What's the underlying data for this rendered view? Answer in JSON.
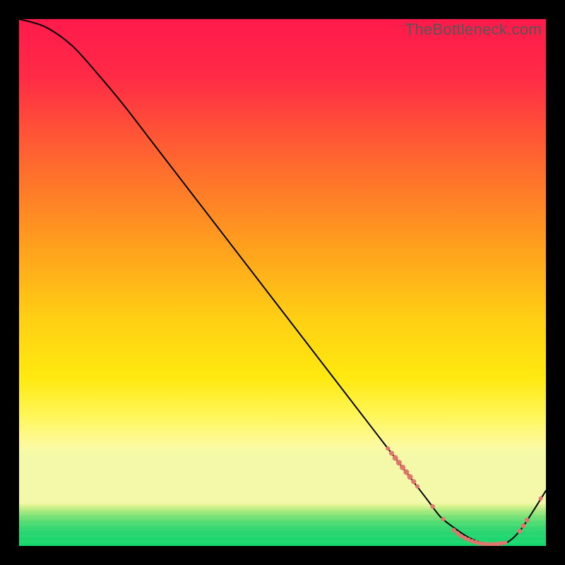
{
  "watermark": "TheBottleneck.com",
  "colors": {
    "frame": "#000000",
    "top": "#ff1a46",
    "mid": "#ffe400",
    "bottom_green": "#14d86d",
    "curve": "#000000",
    "marker": "#e2766d"
  },
  "chart_data": {
    "type": "line",
    "title": "",
    "xlabel": "",
    "ylabel": "",
    "xlim": [
      0,
      100
    ],
    "ylim": [
      0,
      100
    ],
    "series": [
      {
        "name": "bottleneck-curve",
        "x": [
          0,
          5,
          10,
          15,
          20,
          25,
          30,
          35,
          40,
          45,
          50,
          55,
          60,
          65,
          70,
          72.5,
          75,
          77.5,
          80,
          82.5,
          85,
          87.5,
          90,
          92.5,
          95,
          97.5,
          100
        ],
        "values": [
          100,
          98.5,
          95,
          89.5,
          83.5,
          77,
          70.5,
          64,
          57.5,
          51,
          44.5,
          38,
          31.5,
          25,
          18.5,
          15.25,
          12,
          8.75,
          5.5,
          3.5,
          1.8,
          0.7,
          0.3,
          0.6,
          2.8,
          6.5,
          10.5
        ]
      }
    ],
    "markers": {
      "comment": "red clusters of data points along the curve near its minimum and rising tail",
      "points": [
        {
          "x": 70.0,
          "y": 18.5,
          "r": 3.0
        },
        {
          "x": 70.7,
          "y": 17.6,
          "r": 3.5
        },
        {
          "x": 71.4,
          "y": 16.7,
          "r": 4.0
        },
        {
          "x": 72.1,
          "y": 15.8,
          "r": 4.0
        },
        {
          "x": 72.8,
          "y": 14.9,
          "r": 4.0
        },
        {
          "x": 73.5,
          "y": 14.0,
          "r": 4.0
        },
        {
          "x": 74.2,
          "y": 13.1,
          "r": 4.0
        },
        {
          "x": 74.9,
          "y": 12.2,
          "r": 3.5
        },
        {
          "x": 75.6,
          "y": 11.3,
          "r": 3.0
        },
        {
          "x": 78.5,
          "y": 7.5,
          "r": 3.2
        },
        {
          "x": 80.5,
          "y": 5.1,
          "r": 3.0
        },
        {
          "x": 82.5,
          "y": 3.0,
          "r": 3.2
        },
        {
          "x": 83.2,
          "y": 2.4,
          "r": 3.2
        },
        {
          "x": 83.9,
          "y": 1.9,
          "r": 3.2
        },
        {
          "x": 84.6,
          "y": 1.5,
          "r": 3.2
        },
        {
          "x": 85.3,
          "y": 1.2,
          "r": 3.2
        },
        {
          "x": 86.0,
          "y": 0.9,
          "r": 3.2
        },
        {
          "x": 86.7,
          "y": 0.7,
          "r": 3.2
        },
        {
          "x": 87.4,
          "y": 0.5,
          "r": 3.2
        },
        {
          "x": 88.1,
          "y": 0.4,
          "r": 3.2
        },
        {
          "x": 88.8,
          "y": 0.3,
          "r": 3.2
        },
        {
          "x": 89.5,
          "y": 0.3,
          "r": 3.2
        },
        {
          "x": 90.2,
          "y": 0.3,
          "r": 3.2
        },
        {
          "x": 90.9,
          "y": 0.4,
          "r": 3.2
        },
        {
          "x": 91.6,
          "y": 0.5,
          "r": 3.2
        },
        {
          "x": 92.3,
          "y": 0.6,
          "r": 2.8
        },
        {
          "x": 95.0,
          "y": 2.8,
          "r": 3.4
        },
        {
          "x": 95.7,
          "y": 3.8,
          "r": 3.4
        },
        {
          "x": 96.4,
          "y": 4.9,
          "r": 3.4
        },
        {
          "x": 99.0,
          "y": 9.0,
          "r": 3.0
        }
      ]
    }
  }
}
